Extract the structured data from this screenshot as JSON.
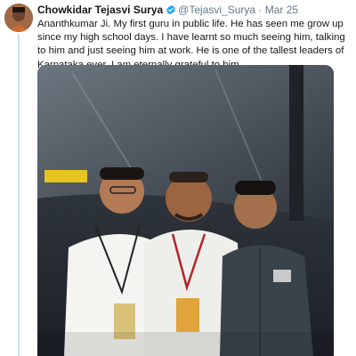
{
  "tweet": {
    "author_name": "Chowkidar Tejasvi Surya",
    "handle": "@Tejasvi_Surya",
    "separator": "·",
    "date": "Mar 25",
    "text": "Ananthkumar Ji. My first guru in public life. He has seen me grow up since my high school days. I have learnt so much seeing him, talking to him and just seeing him at work. He is one of the tallest leaders of Karnataka ever. I am eternally grateful to him."
  },
  "icons": {
    "verified": "verified-badge-icon"
  },
  "colors": {
    "verified": "#1da1f2",
    "thread_line": "#cfe3f1",
    "muted_text": "#657786"
  }
}
